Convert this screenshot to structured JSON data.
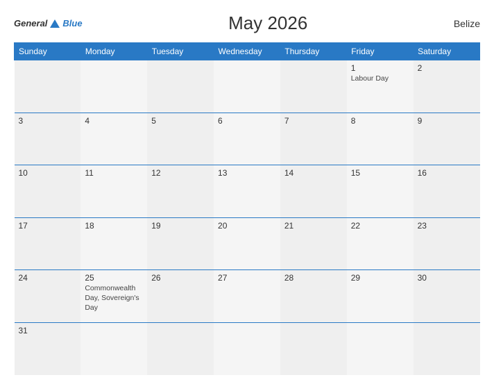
{
  "header": {
    "logo_general": "General",
    "logo_blue": "Blue",
    "title": "May 2026",
    "country": "Belize"
  },
  "weekdays": [
    "Sunday",
    "Monday",
    "Tuesday",
    "Wednesday",
    "Thursday",
    "Friday",
    "Saturday"
  ],
  "weeks": [
    [
      {
        "day": "",
        "event": ""
      },
      {
        "day": "",
        "event": ""
      },
      {
        "day": "",
        "event": ""
      },
      {
        "day": "",
        "event": ""
      },
      {
        "day": "",
        "event": ""
      },
      {
        "day": "1",
        "event": "Labour Day"
      },
      {
        "day": "2",
        "event": ""
      }
    ],
    [
      {
        "day": "3",
        "event": ""
      },
      {
        "day": "4",
        "event": ""
      },
      {
        "day": "5",
        "event": ""
      },
      {
        "day": "6",
        "event": ""
      },
      {
        "day": "7",
        "event": ""
      },
      {
        "day": "8",
        "event": ""
      },
      {
        "day": "9",
        "event": ""
      }
    ],
    [
      {
        "day": "10",
        "event": ""
      },
      {
        "day": "11",
        "event": ""
      },
      {
        "day": "12",
        "event": ""
      },
      {
        "day": "13",
        "event": ""
      },
      {
        "day": "14",
        "event": ""
      },
      {
        "day": "15",
        "event": ""
      },
      {
        "day": "16",
        "event": ""
      }
    ],
    [
      {
        "day": "17",
        "event": ""
      },
      {
        "day": "18",
        "event": ""
      },
      {
        "day": "19",
        "event": ""
      },
      {
        "day": "20",
        "event": ""
      },
      {
        "day": "21",
        "event": ""
      },
      {
        "day": "22",
        "event": ""
      },
      {
        "day": "23",
        "event": ""
      }
    ],
    [
      {
        "day": "24",
        "event": ""
      },
      {
        "day": "25",
        "event": "Commonwealth Day, Sovereign's Day"
      },
      {
        "day": "26",
        "event": ""
      },
      {
        "day": "27",
        "event": ""
      },
      {
        "day": "28",
        "event": ""
      },
      {
        "day": "29",
        "event": ""
      },
      {
        "day": "30",
        "event": ""
      }
    ],
    [
      {
        "day": "31",
        "event": ""
      },
      {
        "day": "",
        "event": ""
      },
      {
        "day": "",
        "event": ""
      },
      {
        "day": "",
        "event": ""
      },
      {
        "day": "",
        "event": ""
      },
      {
        "day": "",
        "event": ""
      },
      {
        "day": "",
        "event": ""
      }
    ]
  ]
}
